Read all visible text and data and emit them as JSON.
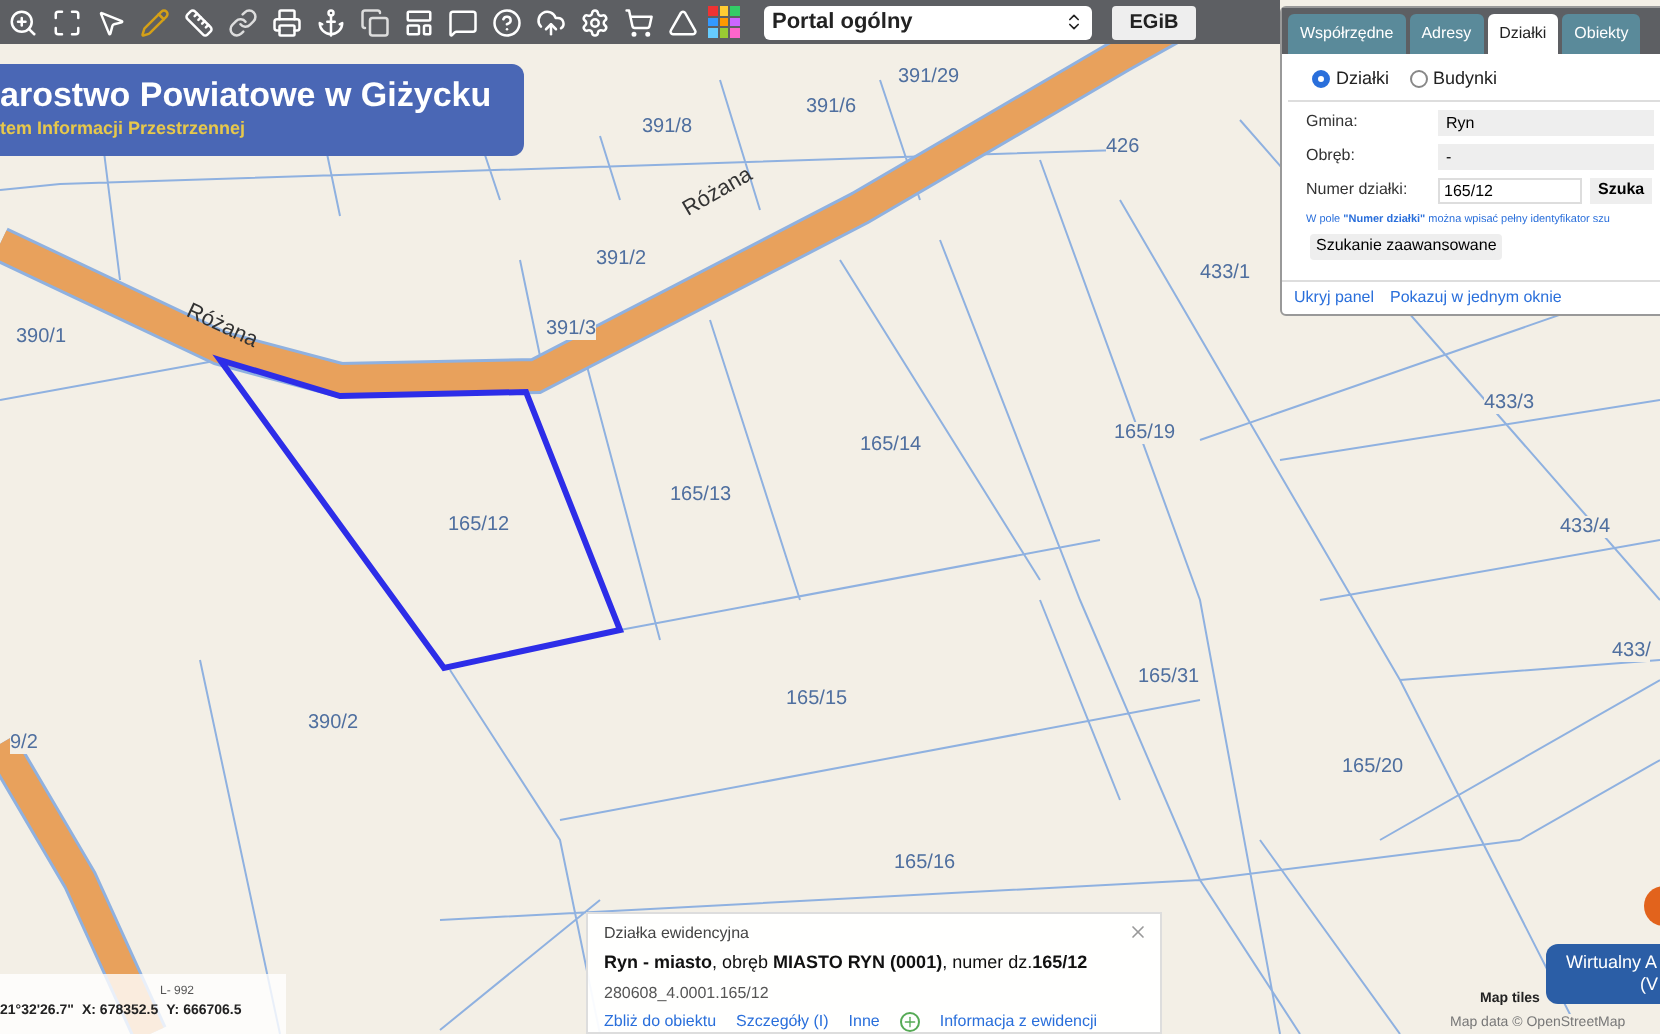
{
  "toolbar": {
    "portal_select": "Portal ogólny",
    "egib_button": "EGiB"
  },
  "logo": {
    "title": "arostwo Powiatowe w Giżycku",
    "subtitle": "tem Informacji Przestrzennej"
  },
  "map": {
    "parcel_labels": [
      "391/8",
      "391/6",
      "391/29",
      "426",
      "391/2",
      "391/3",
      "390/1",
      "433/1",
      "165/14",
      "165/13",
      "165/12",
      "165/19",
      "433/3",
      "433/4",
      "433/",
      "165/31",
      "165/15",
      "390/2",
      "165/20",
      "165/16",
      "9/2"
    ],
    "road_labels": [
      "Różana",
      "Różana"
    ]
  },
  "search_panel": {
    "tabs": [
      {
        "label": "Współrzędne",
        "selected": false
      },
      {
        "label": "Adresy",
        "selected": false
      },
      {
        "label": "Działki",
        "selected": true
      },
      {
        "label": "Obiekty",
        "selected": false
      }
    ],
    "radios": [
      {
        "label": "Działki",
        "selected": true
      },
      {
        "label": "Budynki",
        "selected": false
      }
    ],
    "fields": [
      {
        "label": "Gmina:",
        "value": "Ryn",
        "kind": "select"
      },
      {
        "label": "Obręb:",
        "value": "-",
        "kind": "select"
      },
      {
        "label": "Numer działki:",
        "value": "165/12",
        "kind": "input"
      }
    ],
    "search_button": "Szuka",
    "hint": "W pole **\"Numer działki\"** można wpisać pełny identyfikator szu",
    "advanced_button": "Szukanie zaawansowane",
    "footer_links": [
      "Ukryj panel",
      "Pokazuj w jednym oknie"
    ]
  },
  "info_popup": {
    "title": "Działka ewidencyjna",
    "description": "**Ryn - miasto**, obręb **MIASTO RYN (0001)**, numer dz.**165/12**",
    "identifier": "280608_4.0001.165/12",
    "links": [
      {
        "label": "Zbliż do obiektu",
        "kind": "link"
      },
      {
        "label": "Szczegóły (I)",
        "kind": "link"
      },
      {
        "label": "Inne",
        "kind": "link"
      },
      {
        "kind": "plus"
      },
      {
        "label": "Informacja z ewidencji",
        "kind": "link"
      }
    ]
  },
  "status": {
    "scale": "L- 992",
    "coords": [
      "21°32'26.7\"",
      "X: 678352.5",
      "Y: 666706.5"
    ]
  },
  "attribution": {
    "tiles": "Map tiles",
    "data": "Map data © OpenStreetMap"
  },
  "virtual_button": {
    "lines": [
      "Wirtualny A",
      "(V"
    ]
  }
}
